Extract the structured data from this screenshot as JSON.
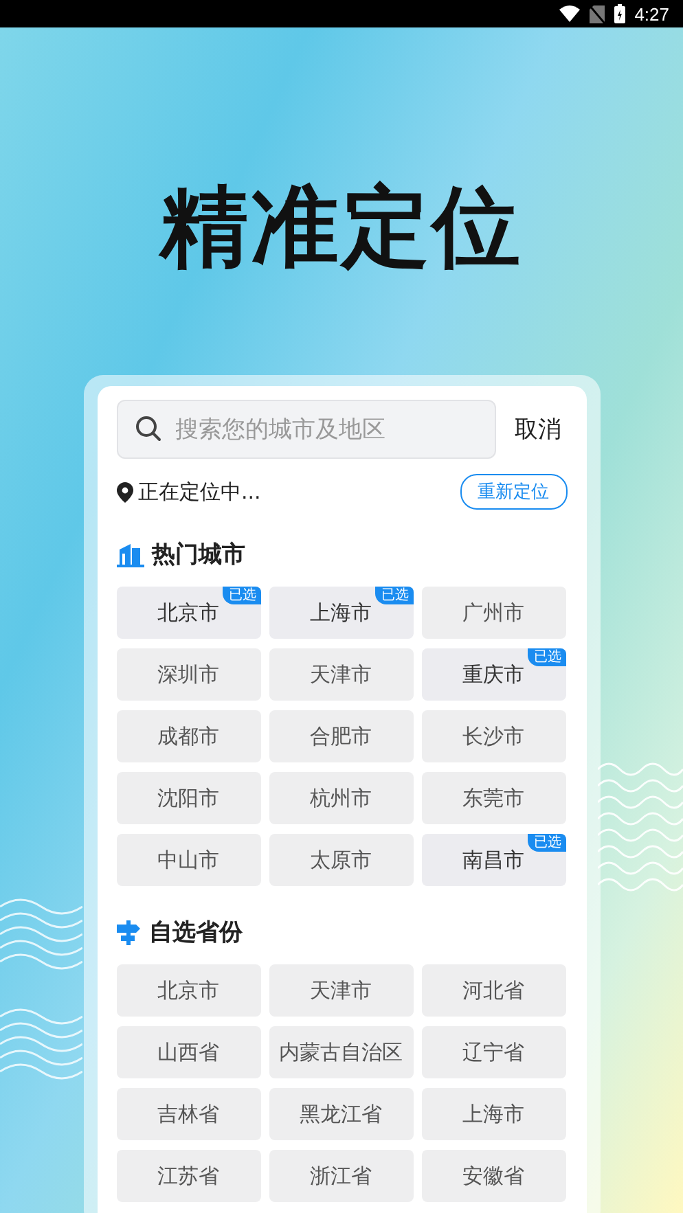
{
  "status_bar": {
    "time": "4:27"
  },
  "title": "精准定位",
  "search": {
    "placeholder": "搜索您的城市及地区",
    "cancel": "取消"
  },
  "location": {
    "status": "正在定位中...",
    "relocate": "重新定位"
  },
  "sections": [
    {
      "kind": "hot",
      "title": "热门城市",
      "items": [
        {
          "label": "北京市",
          "selected": true,
          "badge": "已选"
        },
        {
          "label": "上海市",
          "selected": true,
          "badge": "已选"
        },
        {
          "label": "广州市",
          "selected": false
        },
        {
          "label": "深圳市",
          "selected": false
        },
        {
          "label": "天津市",
          "selected": false
        },
        {
          "label": "重庆市",
          "selected": true,
          "badge": "已选"
        },
        {
          "label": "成都市",
          "selected": false
        },
        {
          "label": "合肥市",
          "selected": false
        },
        {
          "label": "长沙市",
          "selected": false
        },
        {
          "label": "沈阳市",
          "selected": false
        },
        {
          "label": "杭州市",
          "selected": false
        },
        {
          "label": "东莞市",
          "selected": false
        },
        {
          "label": "中山市",
          "selected": false
        },
        {
          "label": "太原市",
          "selected": false
        },
        {
          "label": "南昌市",
          "selected": true,
          "badge": "已选"
        }
      ]
    },
    {
      "kind": "province",
      "title": "自选省份",
      "items": [
        {
          "label": "北京市",
          "selected": false
        },
        {
          "label": "天津市",
          "selected": false
        },
        {
          "label": "河北省",
          "selected": false
        },
        {
          "label": "山西省",
          "selected": false
        },
        {
          "label": "内蒙古自治区",
          "selected": false
        },
        {
          "label": "辽宁省",
          "selected": false
        },
        {
          "label": "吉林省",
          "selected": false
        },
        {
          "label": "黑龙江省",
          "selected": false
        },
        {
          "label": "上海市",
          "selected": false
        },
        {
          "label": "江苏省",
          "selected": false
        },
        {
          "label": "浙江省",
          "selected": false
        },
        {
          "label": "安徽省",
          "selected": false
        }
      ]
    }
  ]
}
